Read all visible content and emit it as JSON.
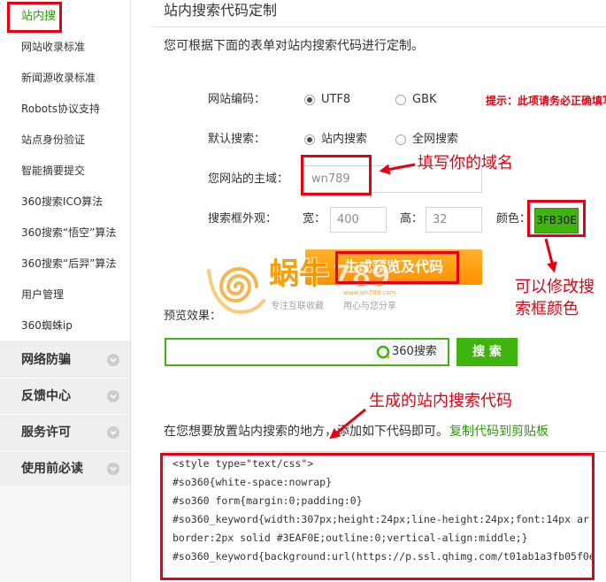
{
  "sidebar": {
    "active_item": "站内搜",
    "items": [
      "网站收录标准",
      "新闻源收录标准",
      "Robots协议支持",
      "站点身份验证",
      "智能摘要提交",
      "360搜索ICO算法",
      "360搜索“悟空”算法",
      "360搜索“后羿”算法",
      "用户管理",
      "360蜘蛛ip"
    ],
    "sections": [
      "网络防骗",
      "反馈中心",
      "服务许可",
      "使用前必读"
    ],
    "section_icon": "chevron-down-icon"
  },
  "main": {
    "title": "站内搜索代码定制",
    "intro": "您可根据下面的表单对站内搜索代码进行定制。",
    "form": {
      "encoding": {
        "label": "网站编码：",
        "options": [
          {
            "label": "UTF8",
            "checked": true
          },
          {
            "label": "GBK",
            "checked": false
          }
        ],
        "hint": "提示：此项请务必正确填写"
      },
      "default_search": {
        "label": "默认搜索：",
        "options": [
          {
            "label": "站内搜索",
            "checked": true
          },
          {
            "label": "全网搜索",
            "checked": false
          }
        ]
      },
      "domain": {
        "label": "您网站的主域：",
        "value": "wn789"
      },
      "appearance": {
        "label": "搜索框外观：",
        "width_label": "宽：",
        "width_value": "400",
        "height_label": "高：",
        "height_value": "32",
        "color_label": "颜色：",
        "color_value": "3FB30E"
      },
      "generate_button": "生成预览及代码"
    },
    "preview": {
      "label": "预览效果：",
      "logo_icon": "360-ring-icon",
      "logo_text": "360搜索",
      "button": "搜 索"
    },
    "code": {
      "instruction": "在您想要放置站内搜索的地方，添加如下代码即可。",
      "copy_link": "复制代码到剪贴板",
      "lines": [
        "<style type=\"text/css\">",
        "#so360{white-space:nowrap}",
        "#so360 form{margin:0;padding:0}",
        "#so360_keyword{width:307px;height:24px;line-height:24px;font:14px ar",
        "border:2px solid #3EAF0E;outline:0;vertical-align:middle;}",
        "#so360_keyword{background:url(https://p.ssl.qhimg.com/t01ab1a3fb05f0e"
      ]
    }
  },
  "annotations": {
    "domain_note": "填写你的域名",
    "color_note_lines": [
      "可以修改搜",
      "索框颜色"
    ],
    "code_note": "生成的站内搜索代码"
  },
  "watermark": {
    "logo_icon": "snail-logo-icon",
    "brand": "蜗牛",
    "number": "789",
    "url": "www.wn789.com",
    "slogans": [
      "专注互联收藏",
      "用心与您分享"
    ]
  },
  "colors": {
    "accent_green": "#3FB30E",
    "link_green": "#2E9B0C",
    "annotation_red": "#E60012",
    "button_orange": "#FF9A0A"
  }
}
